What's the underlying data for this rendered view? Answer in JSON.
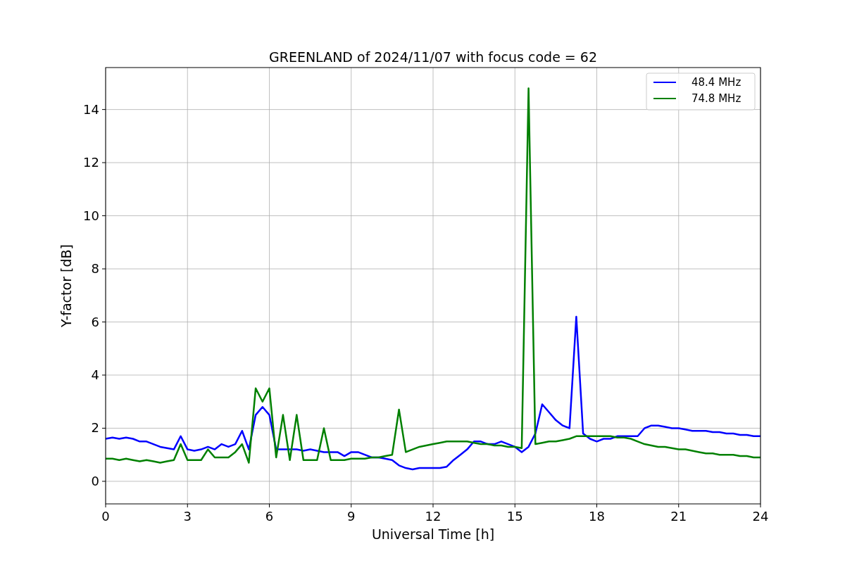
{
  "figure": {
    "chart_data": {
      "type": "line",
      "title": "GREENLAND of 2024/11/07 with focus code = 62",
      "xlabel": "Universal Time [h]",
      "ylabel": "Y-factor [dB]",
      "x": [
        0,
        0.25,
        0.5,
        0.75,
        1,
        1.25,
        1.5,
        1.75,
        2,
        2.25,
        2.5,
        2.75,
        3,
        3.25,
        3.5,
        3.75,
        4,
        4.25,
        4.5,
        4.75,
        5,
        5.25,
        5.5,
        5.75,
        6,
        6.25,
        6.5,
        6.75,
        7,
        7.25,
        7.5,
        7.75,
        8,
        8.25,
        8.5,
        8.75,
        9,
        9.25,
        9.5,
        9.75,
        10,
        10.25,
        10.5,
        10.75,
        11,
        11.25,
        11.5,
        11.75,
        12,
        12.25,
        12.5,
        12.75,
        13,
        13.25,
        13.5,
        13.75,
        14,
        14.25,
        14.5,
        14.75,
        15,
        15.25,
        15.5,
        15.75,
        16,
        16.25,
        16.5,
        16.75,
        17,
        17.25,
        17.5,
        17.75,
        18,
        18.25,
        18.5,
        18.75,
        19,
        19.25,
        19.5,
        19.75,
        20,
        20.25,
        20.5,
        20.75,
        21,
        21.25,
        21.5,
        21.75,
        22,
        22.25,
        22.5,
        22.75,
        23,
        23.25,
        23.5,
        23.75,
        24
      ],
      "series": [
        {
          "name": "48.4 MHz",
          "color": "#0000ff",
          "values": [
            1.6,
            1.65,
            1.6,
            1.65,
            1.6,
            1.5,
            1.5,
            1.4,
            1.3,
            1.25,
            1.2,
            1.7,
            1.2,
            1.15,
            1.2,
            1.3,
            1.2,
            1.4,
            1.3,
            1.4,
            1.9,
            1.2,
            2.5,
            2.8,
            2.5,
            1.2,
            1.2,
            1.2,
            1.2,
            1.15,
            1.2,
            1.15,
            1.1,
            1.1,
            1.1,
            0.95,
            1.1,
            1.1,
            1.0,
            0.9,
            0.9,
            0.85,
            0.8,
            0.6,
            0.5,
            0.45,
            0.5,
            0.5,
            0.5,
            0.5,
            0.55,
            0.8,
            1.0,
            1.2,
            1.5,
            1.5,
            1.4,
            1.4,
            1.5,
            1.4,
            1.3,
            1.1,
            1.3,
            1.8,
            2.9,
            2.6,
            2.3,
            2.1,
            2.0,
            6.2,
            1.8,
            1.6,
            1.5,
            1.6,
            1.6,
            1.7,
            1.7,
            1.7,
            1.7,
            2.0,
            2.1,
            2.1,
            2.05,
            2.0,
            2.0,
            1.95,
            1.9,
            1.9,
            1.9,
            1.85,
            1.85,
            1.8,
            1.8,
            1.75,
            1.75,
            1.7,
            1.7
          ]
        },
        {
          "name": "74.8 MHz",
          "color": "#008000",
          "values": [
            0.85,
            0.85,
            0.8,
            0.85,
            0.8,
            0.75,
            0.8,
            0.75,
            0.7,
            0.75,
            0.8,
            1.4,
            0.8,
            0.8,
            0.8,
            1.2,
            0.9,
            0.9,
            0.9,
            1.1,
            1.4,
            0.7,
            3.5,
            3.0,
            3.5,
            0.9,
            2.5,
            0.8,
            2.5,
            0.8,
            0.8,
            0.8,
            2.0,
            0.8,
            0.8,
            0.8,
            0.85,
            0.85,
            0.85,
            0.9,
            0.9,
            0.95,
            1.0,
            2.7,
            1.1,
            1.2,
            1.3,
            1.35,
            1.4,
            1.45,
            1.5,
            1.5,
            1.5,
            1.5,
            1.45,
            1.4,
            1.4,
            1.35,
            1.35,
            1.3,
            1.3,
            1.25,
            14.8,
            1.4,
            1.45,
            1.5,
            1.5,
            1.55,
            1.6,
            1.7,
            1.7,
            1.7,
            1.7,
            1.7,
            1.7,
            1.65,
            1.65,
            1.6,
            1.5,
            1.4,
            1.35,
            1.3,
            1.3,
            1.25,
            1.2,
            1.2,
            1.15,
            1.1,
            1.05,
            1.05,
            1.0,
            1.0,
            1.0,
            0.95,
            0.95,
            0.9,
            0.9
          ]
        }
      ],
      "grid": true,
      "legend": true,
      "xlim": [
        0,
        24
      ],
      "ylim": [
        -0.85,
        15.58
      ],
      "xticks": [
        0,
        3,
        6,
        9,
        12,
        15,
        18,
        21,
        24
      ],
      "yticks": [
        0,
        2,
        4,
        6,
        8,
        10,
        12,
        14
      ]
    }
  }
}
